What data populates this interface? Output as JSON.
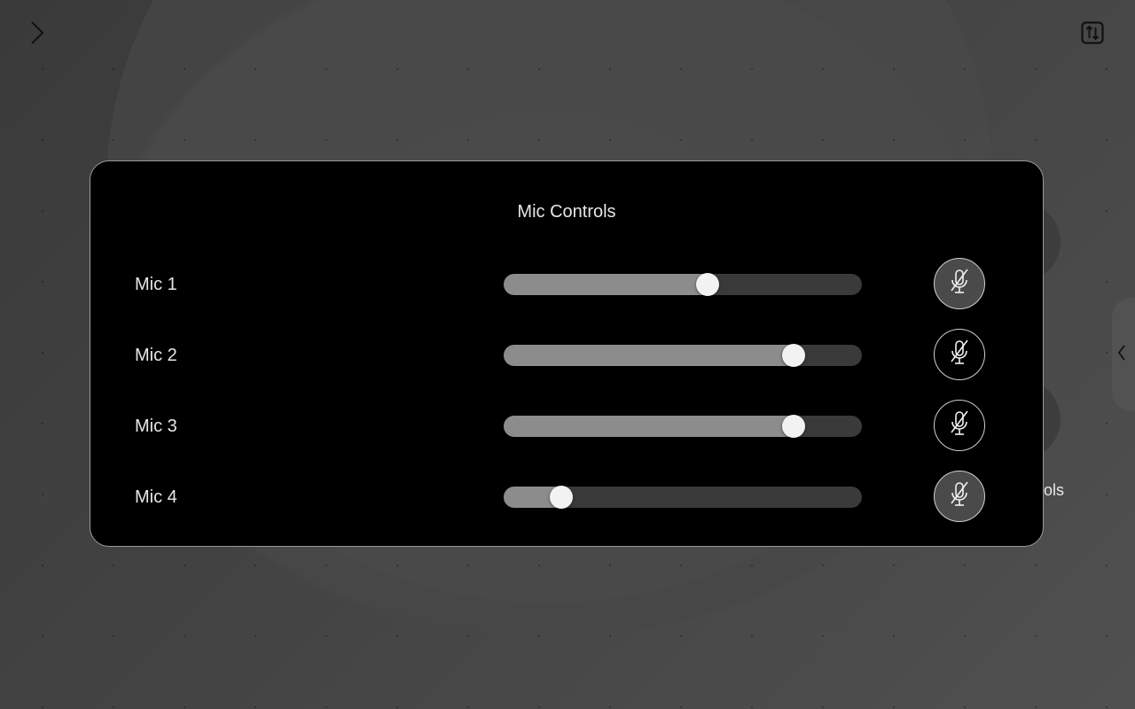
{
  "panel": {
    "title": "Mic Controls"
  },
  "mics": [
    {
      "label": "Mic 1",
      "level": 0.57,
      "mute_icon": "mic-muted-icon",
      "highlighted": true
    },
    {
      "label": "Mic 2",
      "level": 0.81,
      "mute_icon": "mic-muted-icon",
      "highlighted": false
    },
    {
      "label": "Mic 3",
      "level": 0.81,
      "mute_icon": "mic-muted-icon",
      "highlighted": false
    },
    {
      "label": "Mic 4",
      "level": 0.16,
      "mute_icon": "mic-muted-icon",
      "highlighted": true
    }
  ],
  "background": {
    "partial_label": "ols"
  },
  "icons": {
    "top_left": "chevron-right-icon",
    "top_right": "settings-toggle-icon",
    "side_tab": "chevron-left-icon"
  },
  "colors": {
    "panel_bg": "#000000",
    "slider_fill": "#8c8c8c",
    "slider_track": "#3a3a3a",
    "thumb": "#f2f2f2"
  }
}
